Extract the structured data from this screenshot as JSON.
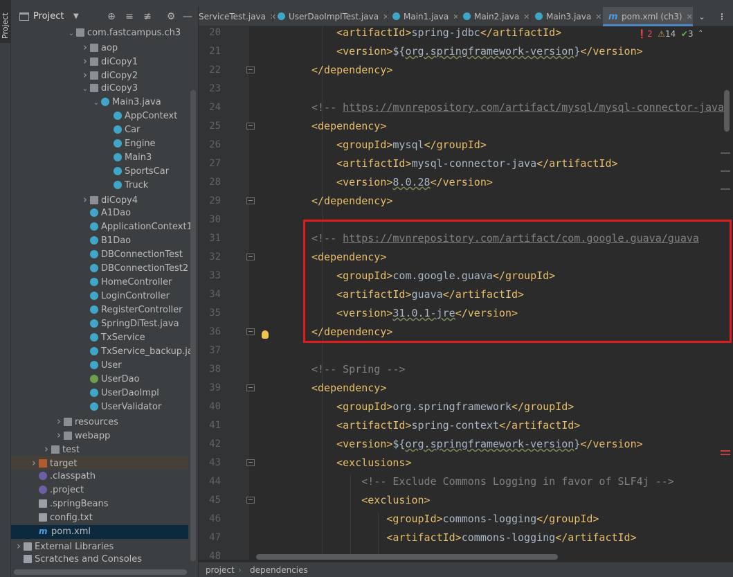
{
  "project_panel": {
    "title": "Project",
    "strip_label": "Project",
    "tree": [
      {
        "label": "com.fastcampus.ch3",
        "icon": "package-icon",
        "arrow": "v"
      },
      {
        "label": "aop",
        "icon": "package-icon",
        "arrow": ">"
      },
      {
        "label": "diCopy1",
        "icon": "package-icon",
        "arrow": ">"
      },
      {
        "label": "diCopy2",
        "icon": "package-icon",
        "arrow": ">"
      },
      {
        "label": "diCopy3",
        "icon": "package-icon",
        "arrow": "v"
      },
      {
        "label": "Main3.java",
        "icon": "class-icon",
        "arrow": "v"
      },
      {
        "label": "AppContext",
        "icon": "class-icon",
        "arrow": ""
      },
      {
        "label": "Car",
        "icon": "class-icon",
        "arrow": ""
      },
      {
        "label": "Engine",
        "icon": "class-icon",
        "arrow": ""
      },
      {
        "label": "Main3",
        "icon": "class-icon",
        "arrow": ""
      },
      {
        "label": "SportsCar",
        "icon": "class-icon",
        "arrow": ""
      },
      {
        "label": "Truck",
        "icon": "class-icon",
        "arrow": ""
      },
      {
        "label": "diCopy4",
        "icon": "package-icon",
        "arrow": ">"
      },
      {
        "label": "A1Dao",
        "icon": "class-icon",
        "arrow": ""
      },
      {
        "label": "ApplicationContext1",
        "icon": "class-icon",
        "arrow": ""
      },
      {
        "label": "B1Dao",
        "icon": "class-icon",
        "arrow": ""
      },
      {
        "label": "DBConnectionTest",
        "icon": "class-icon",
        "arrow": ""
      },
      {
        "label": "DBConnectionTest2",
        "icon": "class-icon",
        "arrow": ""
      },
      {
        "label": "HomeController",
        "icon": "class-icon",
        "arrow": ""
      },
      {
        "label": "LoginController",
        "icon": "class-icon",
        "arrow": ""
      },
      {
        "label": "RegisterController",
        "icon": "class-icon",
        "arrow": ""
      },
      {
        "label": "SpringDiTest.java",
        "icon": "java-file-icon",
        "arrow": ""
      },
      {
        "label": "TxService",
        "icon": "class-icon",
        "arrow": ""
      },
      {
        "label": "TxService_backup.ja",
        "icon": "java-file-icon",
        "arrow": ""
      },
      {
        "label": "User",
        "icon": "class-icon",
        "arrow": ""
      },
      {
        "label": "UserDao",
        "icon": "interface-icon",
        "arrow": ""
      },
      {
        "label": "UserDaoImpl",
        "icon": "class-icon",
        "arrow": ""
      },
      {
        "label": "UserValidator",
        "icon": "class-icon",
        "arrow": ""
      },
      {
        "label": "resources",
        "icon": "folder-icon",
        "arrow": ">"
      },
      {
        "label": "webapp",
        "icon": "folder-icon",
        "arrow": ">"
      },
      {
        "label": "test",
        "icon": "folder-icon",
        "arrow": ">"
      },
      {
        "label": "target",
        "icon": "folder-icon",
        "arrow": ">"
      },
      {
        "label": ".classpath",
        "icon": "eclipse-file-icon",
        "arrow": ""
      },
      {
        "label": ".project",
        "icon": "eclipse-file-icon",
        "arrow": ""
      },
      {
        "label": ".springBeans",
        "icon": "file-icon",
        "arrow": ""
      },
      {
        "label": "config.txt",
        "icon": "text-file-icon",
        "arrow": ""
      },
      {
        "label": "pom.xml",
        "icon": "maven-icon",
        "arrow": ""
      },
      {
        "label": "External Libraries",
        "icon": "library-icon",
        "arrow": ">"
      },
      {
        "label": "Scratches and Consoles",
        "icon": "scratches-icon",
        "arrow": ""
      }
    ]
  },
  "tabs": [
    {
      "label": "ServiceTest.java"
    },
    {
      "label": "UserDaoImplTest.java"
    },
    {
      "label": "Main1.java"
    },
    {
      "label": "Main2.java"
    },
    {
      "label": "Main3.java"
    },
    {
      "label": "pom.xml (ch3)"
    }
  ],
  "inspection": {
    "errors": "2",
    "warnings": "14",
    "ok": "3"
  },
  "lines": [
    {
      "n": "20",
      "parts": [
        [
          "txt",
          "    "
        ],
        [
          "tag",
          "<artifactId>"
        ],
        [
          "txt",
          "spring-jdbc"
        ],
        [
          "tag",
          "</artifactId>"
        ]
      ]
    },
    {
      "n": "21",
      "parts": [
        [
          "txt",
          "    "
        ],
        [
          "tag",
          "<version>"
        ],
        [
          "txt",
          "${"
        ],
        [
          "wavy",
          "org.springframework-version"
        ],
        [
          "txt",
          "}"
        ],
        [
          "tag",
          "</version>"
        ]
      ]
    },
    {
      "n": "22",
      "parts": [
        [
          "tag",
          "</dependency>"
        ]
      ]
    },
    {
      "n": "23",
      "parts": []
    },
    {
      "n": "24",
      "parts": [
        [
          "comment",
          "<!-- "
        ],
        [
          "link",
          "https://mvnrepository.com/artifact/mysql/mysql-connector-java"
        ]
      ]
    },
    {
      "n": "25",
      "parts": [
        [
          "tag",
          "<dependency>"
        ]
      ]
    },
    {
      "n": "26",
      "parts": [
        [
          "txt",
          "    "
        ],
        [
          "tag",
          "<groupId>"
        ],
        [
          "txt",
          "mysql"
        ],
        [
          "tag",
          "</groupId>"
        ]
      ]
    },
    {
      "n": "27",
      "parts": [
        [
          "txt",
          "    "
        ],
        [
          "tag",
          "<artifactId>"
        ],
        [
          "txt",
          "mysql-connector-java"
        ],
        [
          "tag",
          "</artifactId>"
        ]
      ]
    },
    {
      "n": "28",
      "parts": [
        [
          "txt",
          "    "
        ],
        [
          "tag",
          "<version>"
        ],
        [
          "wavy",
          "8.0.28"
        ],
        [
          "tag",
          "</version>"
        ]
      ]
    },
    {
      "n": "29",
      "parts": [
        [
          "tag",
          "</dependency>"
        ]
      ]
    },
    {
      "n": "30",
      "parts": []
    },
    {
      "n": "31",
      "parts": [
        [
          "comment",
          "<!-- "
        ],
        [
          "link",
          "https://mvnrepository.com/artifact/com.google.guava/guava"
        ]
      ]
    },
    {
      "n": "32",
      "parts": [
        [
          "tag",
          "<dependency>"
        ]
      ]
    },
    {
      "n": "33",
      "parts": [
        [
          "txt",
          "    "
        ],
        [
          "tag",
          "<groupId>"
        ],
        [
          "txt",
          "com.google.guava"
        ],
        [
          "tag",
          "</groupId>"
        ]
      ]
    },
    {
      "n": "34",
      "parts": [
        [
          "txt",
          "    "
        ],
        [
          "tag",
          "<artifactId>"
        ],
        [
          "txt",
          "guava"
        ],
        [
          "tag",
          "</artifactId>"
        ]
      ]
    },
    {
      "n": "35",
      "parts": [
        [
          "txt",
          "    "
        ],
        [
          "tag",
          "<version>"
        ],
        [
          "wavy",
          "31.0.1-jre"
        ],
        [
          "tag",
          "</version>"
        ]
      ]
    },
    {
      "n": "36",
      "parts": [
        [
          "tag",
          "</dependency>"
        ]
      ]
    },
    {
      "n": "37",
      "parts": []
    },
    {
      "n": "38",
      "parts": [
        [
          "comment",
          "<!-- Spring -->"
        ]
      ]
    },
    {
      "n": "39",
      "parts": [
        [
          "tag",
          "<dependency>"
        ]
      ]
    },
    {
      "n": "40",
      "parts": [
        [
          "txt",
          "    "
        ],
        [
          "tag",
          "<groupId>"
        ],
        [
          "txt",
          "org.springframework"
        ],
        [
          "tag",
          "</groupId>"
        ]
      ]
    },
    {
      "n": "41",
      "parts": [
        [
          "txt",
          "    "
        ],
        [
          "tag",
          "<artifactId>"
        ],
        [
          "txt",
          "spring-context"
        ],
        [
          "tag",
          "</artifactId>"
        ]
      ]
    },
    {
      "n": "42",
      "parts": [
        [
          "txt",
          "    "
        ],
        [
          "tag",
          "<version>"
        ],
        [
          "txt",
          "${"
        ],
        [
          "wavy",
          "org.springframework-version"
        ],
        [
          "txt",
          "}"
        ],
        [
          "tag",
          "</version>"
        ]
      ]
    },
    {
      "n": "43",
      "parts": [
        [
          "txt",
          "    "
        ],
        [
          "tag",
          "<exclusions>"
        ]
      ]
    },
    {
      "n": "44",
      "parts": [
        [
          "txt",
          "        "
        ],
        [
          "comment",
          "<!-- Exclude Commons Logging in favor of SLF4j -->"
        ]
      ]
    },
    {
      "n": "45",
      "parts": [
        [
          "txt",
          "        "
        ],
        [
          "tag",
          "<exclusion>"
        ]
      ]
    },
    {
      "n": "46",
      "parts": [
        [
          "txt",
          "            "
        ],
        [
          "tag",
          "<groupId>"
        ],
        [
          "txt",
          "commons-logging"
        ],
        [
          "tag",
          "</groupId>"
        ]
      ]
    },
    {
      "n": "47",
      "parts": [
        [
          "txt",
          "            "
        ],
        [
          "tag",
          "<artifactId>"
        ],
        [
          "txt",
          "commons-logging"
        ],
        [
          "tag",
          "</artifactId>"
        ]
      ]
    },
    {
      "n": "48",
      "parts": []
    }
  ],
  "breadcrumb": {
    "item1": "project",
    "sep": "›",
    "item2": "dependencies"
  },
  "colors": {
    "accent": "#4a88c7",
    "highlight_box": "#e01b1b",
    "tag": "#e8bf6a",
    "comment": "#808080"
  }
}
